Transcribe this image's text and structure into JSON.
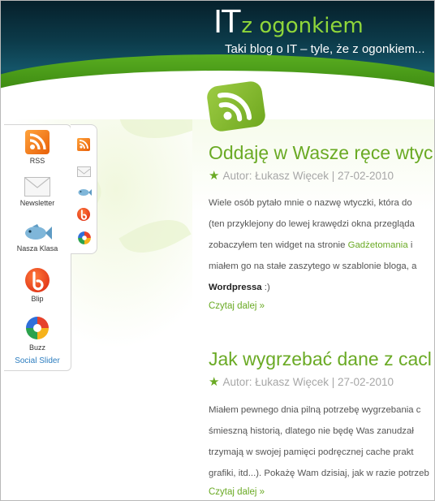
{
  "header": {
    "logo_main": "IT",
    "logo_sub": "z ogonkiem",
    "tagline": "Taki blog o IT – tyle, że z ogonkiem..."
  },
  "social_slider": {
    "title": "Social Slider",
    "items": [
      {
        "label": "RSS",
        "icon": "rss-icon"
      },
      {
        "label": "Newsletter",
        "icon": "envelope-icon"
      },
      {
        "label": "Nasza Klasa",
        "icon": "fish-icon"
      },
      {
        "label": "Blip",
        "icon": "blip-icon"
      },
      {
        "label": "Buzz",
        "icon": "buzz-icon"
      }
    ]
  },
  "posts": [
    {
      "title": "Oddaję w Wasze ręce wtyc",
      "meta": "Autor: Łukasz Więcek | 27-02-2010",
      "lines": [
        "Wiele osób pytało mnie o nazwę wtyczki, która do",
        "(ten przyklejony do lewej krawędzi okna przegląda",
        "zobaczyłem ten widget na stronie",
        "Gadżetomania",
        " i",
        "miałem go na stałe zaszytego w szablonie bloga, a",
        "Wordpressa",
        " :)"
      ],
      "read_more": "Czytaj dalej »"
    },
    {
      "title": "Jak wygrzebać dane z cacl",
      "meta": "Autor: Łukasz Więcek | 27-02-2010",
      "lines": [
        "Miałem pewnego dnia pilną potrzebę wygrzebania c",
        "śmieszną historią, dlatego nie będę Was zanudzał",
        "trzymają w swojej pamięci podręcznej cache prakt",
        "grafiki, itd...). Pokażę Wam dzisiaj, jak w razie potrzeb"
      ],
      "read_more": "Czytaj dalej »"
    }
  ],
  "colors": {
    "accent_green": "#6aaa24",
    "header_dark": "#0c3b4a",
    "link_blue": "#2c7dbf"
  }
}
